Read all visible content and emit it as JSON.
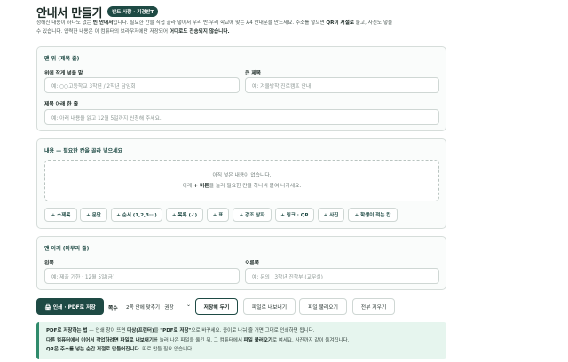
{
  "header": {
    "title": "안내서 만들기",
    "badge": "반드 사항 · 기경반T"
  },
  "intro": {
    "line1_pre": "정해진 내용이 하나도 없는 ",
    "line1_bold": "빈 안내서",
    "line1_post": "입니다. 필요한 칸을 직접 골라 넣어서 우리 반·우리 학교에 맞는 A4 안내문을 만드세요. 주소를 넣으면 ",
    "line1_bold2": "QR이 저절로",
    "line1_end": " 붙고, 사진도 넣을",
    "line2_pre": "수 있습니다. 입력한 내용은 이 컴퓨터의 브라우저에만 저장되어 ",
    "line2_bold": "어디로도 전송되지 않습니다."
  },
  "top_section": {
    "title": "맨 위 (제목 줄)",
    "field1_label": "위에 작게 넣을 말",
    "field1_placeholder": "예: ○○고등학교 3학년 / 2학년 담임회",
    "field2_label": "큰 제목",
    "field2_placeholder": "예: 겨울방학 진로캠프 안내",
    "field3_label": "제목 아래 한 줄",
    "field3_placeholder": "예: 아래 내용을 읽고 12월 5일까지 신청해 주세요."
  },
  "content_section": {
    "title": "내용 — 필요한 칸을 골라 넣으세요",
    "empty_line1": "아직 넣은 내용이 없습니다.",
    "empty_line2_pre": "아래 ",
    "empty_line2_bold": "+ 버튼",
    "empty_line2_post": "을 눌러 필요한 칸을 하나씩 붙여 나가세요.",
    "buttons": [
      "+ 소제목",
      "+ 문단",
      "+ 순서 (1,2,3···)",
      "+ 목록 (✓)",
      "+ 표",
      "+ 강조 상자",
      "+ 링크 · QR",
      "+ 사진",
      "+ 학생이 적는 칸"
    ]
  },
  "bottom_section": {
    "title": "맨 아래 (마무리 줄)",
    "left_label": "왼쪽",
    "left_placeholder": "예: 제출 기한 · 12월 5일(금)",
    "right_label": "오른쪽",
    "right_placeholder": "예: 문의 · 3학년 진학부 (교무실)"
  },
  "toolbar": {
    "print_label": "🖨 인쇄 · PDF로 저장",
    "copies_label": "쪽수",
    "copies_value": "2쪽 안에 맞추기 · 권장",
    "save_label": "저장해 두기",
    "export_label": "파일로 내보내기",
    "import_label": "파일 불러오기",
    "clear_label": "전부 지우기"
  },
  "note": {
    "l1_b1": "PDF로 저장하는 법",
    "l1_t1": " — 인쇄 창이 뜨면 ",
    "l1_b2": "대상(프린터)",
    "l1_t2": "을 ",
    "l1_b3": "\"PDF로 저장\"",
    "l1_t3": "으로 바꾸세요. 종이로 나눠 줄 거면 그대로 인쇄하면 됩니다.",
    "l2_b1": "다른 컴퓨터에서 이어서 작업하려면 파일로 내보내기",
    "l2_t1": "를 눌러 나온 파일을 옮긴 뒤, 그 컴퓨터에서 ",
    "l2_b2": "파일 불러오기",
    "l2_t2": "로 여세요. 사진까지 같이 옮겨집니다.",
    "l3_b1": "QR은 주소를 넣는 순간 저절로 만들어집니다.",
    "l3_t1": " 따로 만들 필요 없습니다."
  }
}
